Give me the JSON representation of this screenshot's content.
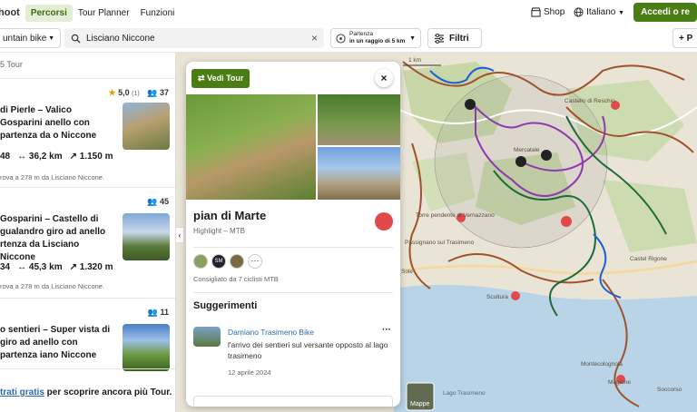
{
  "topbar": {
    "brand": "hoot",
    "nav": [
      "Percorsi",
      "Tour Planner",
      "Funzioni"
    ],
    "shop": "Shop",
    "language": "Italiano",
    "login": "Accedi o re"
  },
  "filters": {
    "sport": "untain bike",
    "search_value": "Lisciano Niccone",
    "radius_line1": "Partenza",
    "radius_line2": "in un raggio di 5 km",
    "filters_label": "Filtri",
    "plus_label": "+ P"
  },
  "list": {
    "count_label": "5 Tour",
    "cards": [
      {
        "title": "di Pierle – Valico Gosparini anello con partenza da o Niccone",
        "rating": "5,0",
        "rating_count": "(1)",
        "users": "37",
        "dur": "48",
        "distance": "36,2 km",
        "ascent": "1.150 m",
        "near": "rova a 278 m da Lisciano Niccone."
      },
      {
        "title": "Gosparini – Castello di gualandro giro ad anello rtenza da Lisciano Niccone",
        "users": "45",
        "dur": "34",
        "distance": "45,3 km",
        "ascent": "1.320 m",
        "near": "rova a 278 m da Lisciano Niccone."
      },
      {
        "title": "o sentieri – Super vista di giro ad anello con partenza iano Niccone",
        "users": "11"
      }
    ],
    "cta_link": "trati gratis",
    "cta_text": " per scoprire ancora più Tour."
  },
  "popup": {
    "vedi_tour": "Vedi Tour",
    "title": "pian di Marte",
    "subtitle": "Highlight – MTB",
    "avatar_initials": "SM",
    "recommended": "Consigliato da 7 ciclisti MTB",
    "suggestions_heading": "Suggerimenti",
    "comment": {
      "author": "Damiano Trasimeno Bike",
      "text": "l'arrivo dei sentieri sul versante opposto al lago trasimeno",
      "date": "12 aprile 2024"
    }
  },
  "map": {
    "scale": "1 km",
    "layer_button": "Mappe",
    "labels": [
      "Castello di Reschio",
      "Mercatale",
      "Torre pendente di Vernazzano",
      "Passignano sul Trasimeno",
      "Castel Rigone",
      "Sole",
      "Scultura",
      "Lago Trasimeno",
      "Montecolognola",
      "Magione",
      "Soccorso"
    ]
  }
}
